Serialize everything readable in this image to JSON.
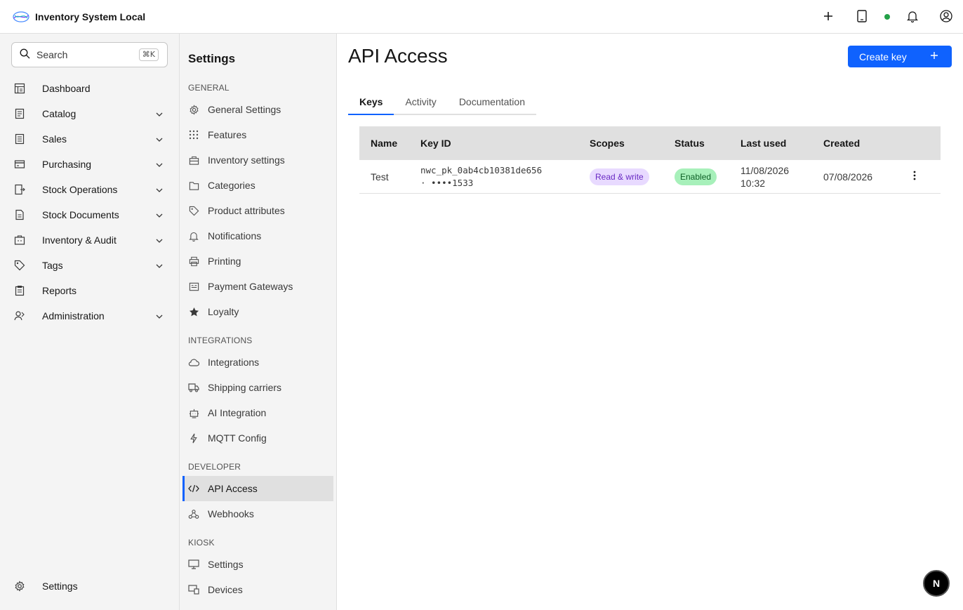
{
  "app": {
    "title": "Inventory System Local"
  },
  "header": {
    "actions": [
      {
        "icon": "plus-icon"
      },
      {
        "icon": "tablet-icon"
      },
      {
        "icon": "status-online-dot"
      },
      {
        "icon": "bell-icon"
      },
      {
        "icon": "user-avatar-icon"
      }
    ]
  },
  "search": {
    "label": "Search",
    "shortcut": "⌘K"
  },
  "sidebar": {
    "items": [
      {
        "label": "Dashboard",
        "icon": "dashboard-icon",
        "expandable": false
      },
      {
        "label": "Catalog",
        "icon": "catalog-icon",
        "expandable": true
      },
      {
        "label": "Sales",
        "icon": "sales-icon",
        "expandable": true
      },
      {
        "label": "Purchasing",
        "icon": "credit-card-icon",
        "expandable": true
      },
      {
        "label": "Stock Operations",
        "icon": "stock-operations-icon",
        "expandable": true
      },
      {
        "label": "Stock Documents",
        "icon": "document-icon",
        "expandable": true
      },
      {
        "label": "Inventory & Audit",
        "icon": "audit-icon",
        "expandable": true
      },
      {
        "label": "Tags",
        "icon": "tag-icon",
        "expandable": true
      },
      {
        "label": "Reports",
        "icon": "report-icon",
        "expandable": false
      },
      {
        "label": "Administration",
        "icon": "user-admin-icon",
        "expandable": true
      }
    ],
    "bottom": {
      "label": "Settings",
      "icon": "gear-icon"
    }
  },
  "settings_nav": {
    "title": "Settings",
    "sections": {
      "general": "GENERAL",
      "integrations": "INTEGRATIONS",
      "developer": "DEVELOPER",
      "kiosk": "KIOSK"
    },
    "general_items": [
      "General Settings",
      "Features",
      "Inventory settings",
      "Categories",
      "Product attributes",
      "Notifications",
      "Printing",
      "Payment Gateways",
      "Loyalty"
    ],
    "integration_items": [
      "Integrations",
      "Shipping carriers",
      "AI Integration",
      "MQTT Config"
    ],
    "developer_items": [
      "API Access",
      "Webhooks"
    ],
    "kiosk_items": [
      "Settings",
      "Devices"
    ],
    "active": "API Access"
  },
  "main": {
    "title": "API Access",
    "create_button": "Create key",
    "tabs": [
      "Keys",
      "Activity",
      "Documentation"
    ],
    "active_tab": "Keys",
    "table": {
      "headers": [
        "Name",
        "Key ID",
        "Scopes",
        "Status",
        "Last used",
        "Created"
      ],
      "rows": [
        {
          "name": "Test",
          "key_line1": "nwc_pk_0ab4cb10381de656",
          "key_line2": "· ••••1533",
          "scope": "Read & write",
          "status": "Enabled",
          "last_used_date": "11/08/2026",
          "last_used_time": "10:32",
          "created": "07/08/2026"
        }
      ]
    }
  },
  "fab": {
    "label": "N"
  },
  "colors": {
    "primary": "#0f62fe",
    "success": "#24a148",
    "scope_bg": "#e8daff",
    "status_bg": "#a7f0ba"
  }
}
